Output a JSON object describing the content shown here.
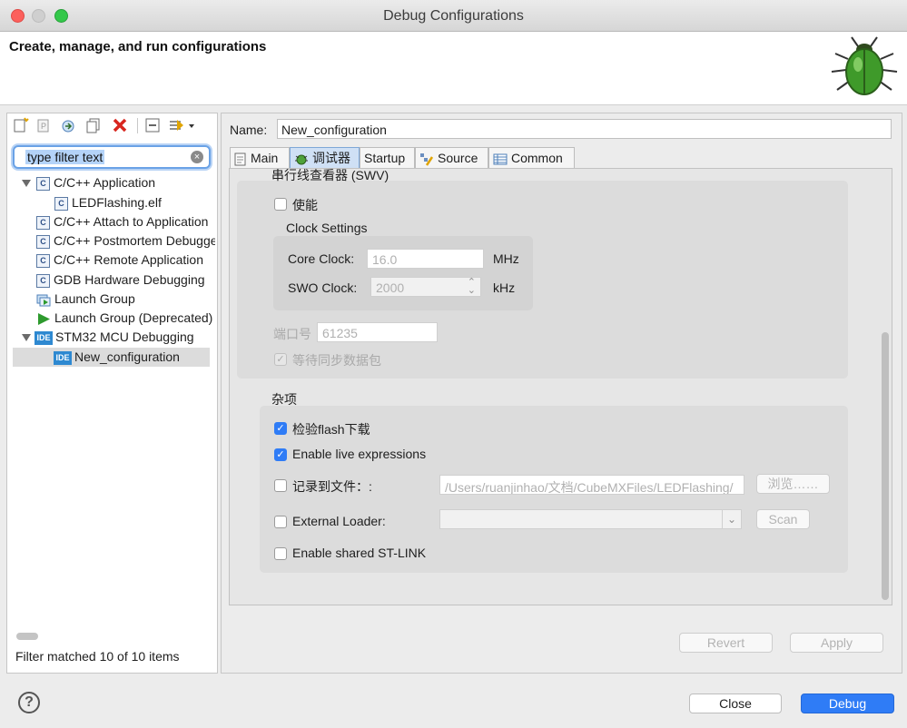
{
  "window": {
    "title": "Debug Configurations"
  },
  "header": {
    "title": "Create, manage, and run configurations"
  },
  "sidebar": {
    "filter_placeholder": "type filter text",
    "tree": [
      {
        "label": "C/C++ Application"
      },
      {
        "label": "LEDFlashing.elf"
      },
      {
        "label": "C/C++ Attach to Application"
      },
      {
        "label": "C/C++ Postmortem Debugger"
      },
      {
        "label": "C/C++ Remote Application"
      },
      {
        "label": "GDB Hardware Debugging"
      },
      {
        "label": "Launch Group"
      },
      {
        "label": "Launch Group (Deprecated)"
      },
      {
        "label": "STM32 MCU Debugging"
      },
      {
        "label": "New_configuration"
      }
    ],
    "status": "Filter matched 10 of 10 items"
  },
  "main": {
    "name_label": "Name:",
    "name_value": "New_configuration",
    "tabs": [
      {
        "label": "Main"
      },
      {
        "label": "调试器"
      },
      {
        "label": "Startup"
      },
      {
        "label": "Source"
      },
      {
        "label": "Common"
      }
    ],
    "swv": {
      "group_title": "串行线查看器 (SWV)",
      "enable_label": "使能",
      "clock_group_title": "Clock Settings",
      "core_clock_label": "Core Clock:",
      "core_clock_value": "16.0",
      "core_clock_unit": "MHz",
      "swo_clock_label": "SWO Clock:",
      "swo_clock_value": "2000",
      "swo_clock_unit": "kHz",
      "port_label": "端口号",
      "port_value": "61235",
      "wait_sync_label": "等待同步数据包"
    },
    "misc": {
      "group_title": "杂项",
      "verify_flash_label": "检验flash下载",
      "live_expr_label": "Enable live expressions",
      "log_file_label": "记录到文件：:",
      "log_file_value": "/Users/ruanjinhao/文档/CubeMXFiles/LEDFlashing/",
      "browse_label": "浏览……",
      "ext_loader_label": "External Loader:",
      "scan_label": "Scan",
      "shared_stlink_label": "Enable shared ST-LINK"
    },
    "revert_label": "Revert",
    "apply_label": "Apply"
  },
  "footer": {
    "help_label": "?",
    "close_label": "Close",
    "debug_label": "Debug"
  },
  "colors": {
    "primary_button": "#2f7cf6",
    "accent_check": "#2f7cf6"
  }
}
